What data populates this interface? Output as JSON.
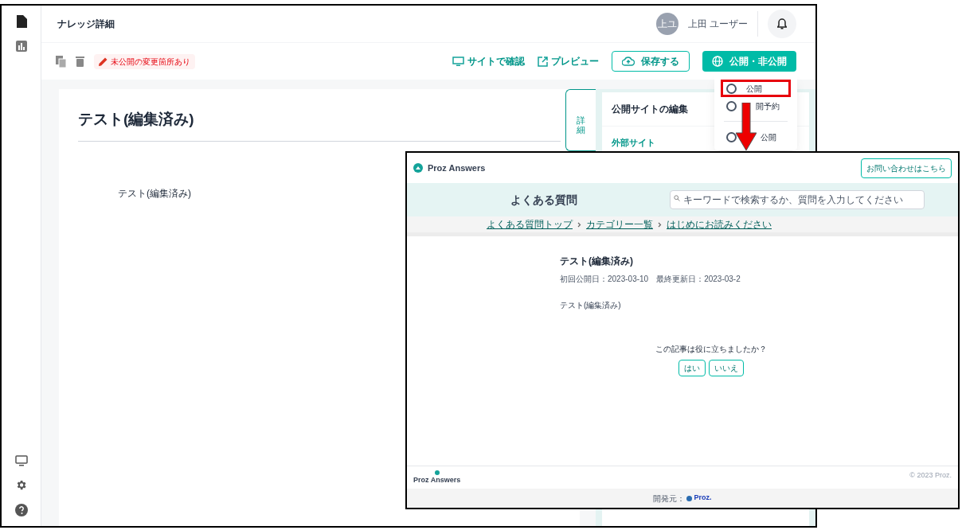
{
  "header": {
    "title": "ナレッジ詳細",
    "avatar": "上ユ",
    "user_name": "上田 ユーザー"
  },
  "toolbar": {
    "badge": "未公開の変更箇所あり",
    "actions": [
      {
        "kind": "link",
        "label": "サイトで確認"
      },
      {
        "kind": "link",
        "label": "プレビュー"
      },
      {
        "kind": "outline",
        "label": "保存する"
      },
      {
        "kind": "primary",
        "label": "公開・非公開"
      }
    ]
  },
  "article": {
    "title": "テスト(編集済み)",
    "body": "テスト(編集済み)"
  },
  "side_tab": {
    "label": "詳細",
    "selected": true
  },
  "side_panel": {
    "title": "公開サイトの編集",
    "section": "外部サイト"
  },
  "publish_menu": {
    "options": [
      {
        "label": "公開",
        "selected": false,
        "highlighted": true
      },
      {
        "label": "開予約",
        "selected": false,
        "highlighted": false
      },
      {
        "label": "公開",
        "selected": false,
        "highlighted": false
      }
    ]
  },
  "preview": {
    "brand": "Proz Answers",
    "contact_button": "お問い合わせはこちら",
    "hero_title": "よくある質問",
    "search": {
      "placeholder": "キーワードで検索するか、質問を入力してください"
    },
    "breadcrumbs": [
      "よくある質問トップ",
      "カテゴリー一覧",
      "はじめにお読みください"
    ],
    "article_title": "テスト(編集済み)",
    "dates": "初回公開日：2023-03-10　最終更新日：2023-03-2",
    "body": "テスト(編集済み)",
    "feedback": {
      "question": "この記事は役に立ちましたか？",
      "buttons": [
        "はい",
        "いいえ"
      ]
    },
    "footer": {
      "brand": "Proz Answers",
      "copyright": "© 2023 Proz.",
      "developer_label": "開発元：",
      "developer": "Proz."
    }
  }
}
